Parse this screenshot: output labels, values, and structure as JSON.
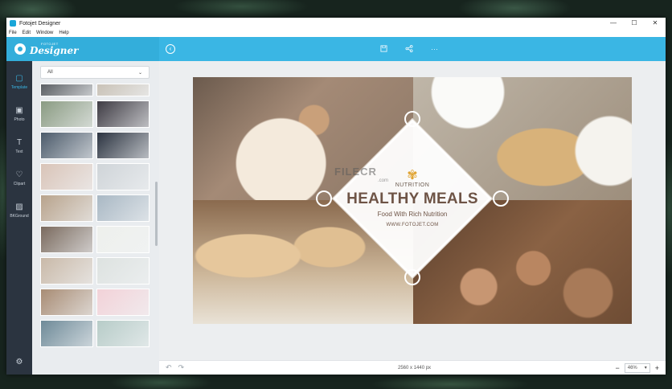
{
  "window": {
    "title": "Fotojet Designer",
    "controls": [
      "—",
      "☐",
      "✕"
    ]
  },
  "menu": [
    "File",
    "Edit",
    "Window",
    "Help"
  ],
  "brand": {
    "small": "FOTOJET",
    "big": "Designer"
  },
  "toolbar": {
    "back": "‹",
    "save_icon": "save-icon",
    "share_icon": "share-icon",
    "more": "···"
  },
  "nav": [
    {
      "label": "Template",
      "icon": "▢"
    },
    {
      "label": "Photo",
      "icon": "▣"
    },
    {
      "label": "Text",
      "icon": "T"
    },
    {
      "label": "Clipart",
      "icon": "♡"
    },
    {
      "label": "BKGround",
      "icon": "▨"
    }
  ],
  "panel": {
    "filter": "All",
    "thumb_colors": [
      [
        "#5b5f63",
        "#c9c2b7"
      ],
      [
        "#8a9b82",
        "#3e3b43"
      ],
      [
        "#4b5a6a",
        "#2b3340"
      ],
      [
        "#d9c4b8",
        "#cfd4d8"
      ],
      [
        "#b8a38c",
        "#a9b8c4"
      ],
      [
        "#7a6a5e",
        "#eef0ec"
      ],
      [
        "#c9b9a8",
        "#dde2e0"
      ],
      [
        "#a88c74",
        "#f2d2d8"
      ],
      [
        "#6e8a98",
        "#b7ccc8"
      ]
    ]
  },
  "canvas": {
    "watermark": "FILECR",
    "watermark_sub": ".com",
    "nutrition": "NUTRITION",
    "title": "HEALTHY MEALS",
    "subtitle": "Food With Rich Nutrition",
    "url": "WWW.FOTOJET.COM"
  },
  "status": {
    "dimensions": "2560 x 1440 px",
    "zoom": "46%",
    "zoom_out": "−",
    "zoom_in": "+"
  }
}
